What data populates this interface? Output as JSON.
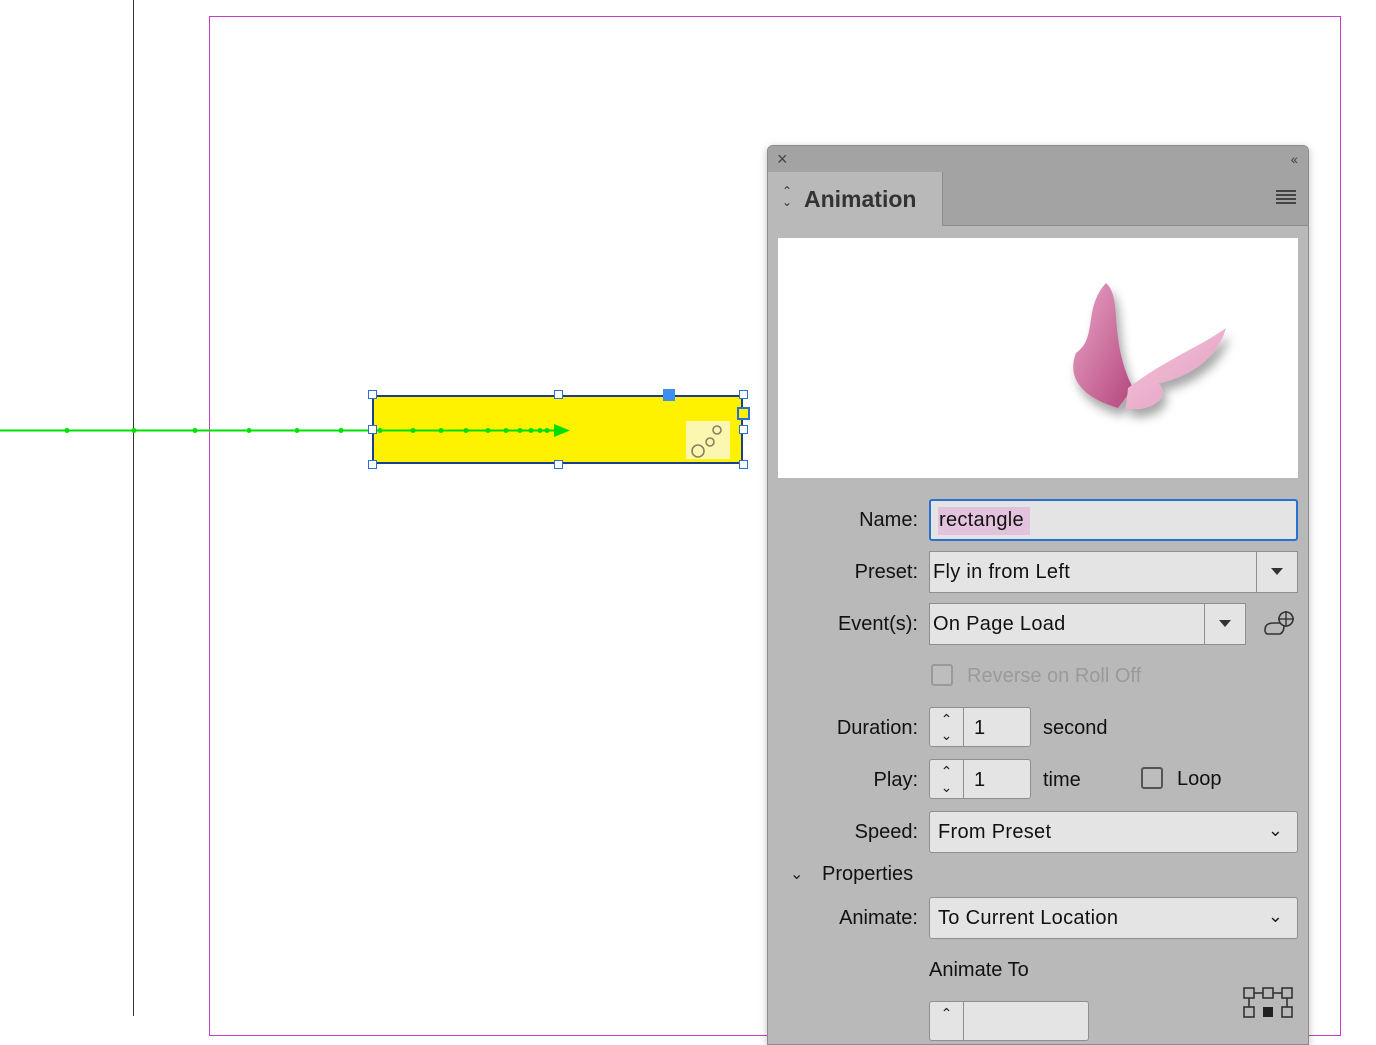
{
  "panel": {
    "close_icon": "×",
    "collapse_icon": "‹‹",
    "tab_arrows": "⌃⌄",
    "tab_title": "Animation",
    "preview": "butterfly-preview"
  },
  "form": {
    "name_label": "Name:",
    "name_value": "rectangle",
    "preset_label": "Preset:",
    "preset_value": "Fly in from Left",
    "events_label": "Event(s):",
    "events_value": "On Page Load",
    "reverse_label": "Reverse on Roll Off",
    "duration_label": "Duration:",
    "duration_value": "1",
    "duration_unit": "second",
    "play_label": "Play:",
    "play_value": "1",
    "play_unit": "time",
    "loop_label": "Loop",
    "speed_label": "Speed:",
    "speed_value": "From Preset",
    "properties_label": "Properties",
    "animate_label": "Animate:",
    "animate_value": "To Current Location",
    "animate_to_label": "Animate To"
  },
  "colors": {
    "object_fill": "#fff200",
    "motion_path": "#00e000",
    "page_frame": "#c33fc8",
    "selection": "#2b6fd1",
    "focus_ring": "#2b6fd1"
  }
}
